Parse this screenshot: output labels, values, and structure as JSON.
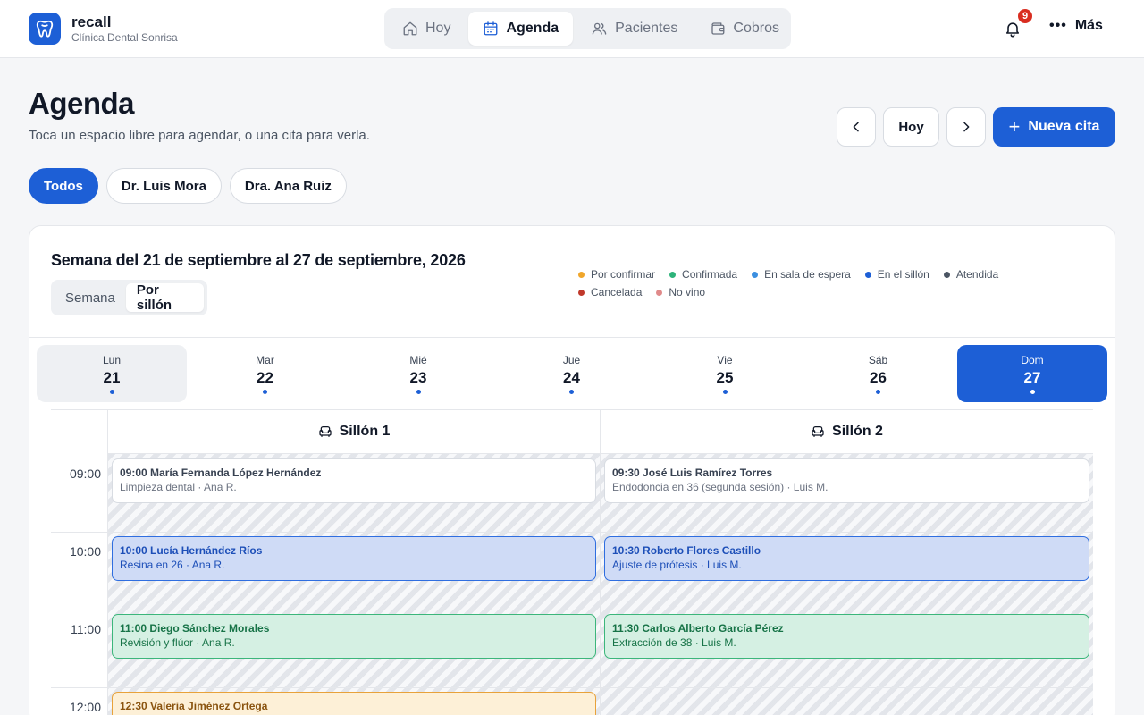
{
  "brand": {
    "name": "recall",
    "clinic": "Clínica Dental Sonrisa"
  },
  "nav": {
    "tabs": [
      {
        "label": "Hoy",
        "icon": "home-icon"
      },
      {
        "label": "Agenda",
        "icon": "calendar-icon"
      },
      {
        "label": "Pacientes",
        "icon": "users-icon"
      },
      {
        "label": "Cobros",
        "icon": "wallet-icon"
      }
    ],
    "active": "Agenda",
    "notifications": "9",
    "more_label": "Más"
  },
  "header": {
    "title": "Agenda",
    "subtitle": "Toca un espacio libre para agendar, o una cita para verla.",
    "today_label": "Hoy",
    "new_label": "Nueva cita"
  },
  "filters": {
    "chips": [
      "Todos",
      "Dr. Luis Mora",
      "Dra. Ana Ruiz"
    ],
    "active": "Todos"
  },
  "week": {
    "title": "Semana del 21 de septiembre al 27 de septiembre, 2026",
    "views": [
      "Semana",
      "Por sillón"
    ],
    "active_view": "Por sillón"
  },
  "legend": [
    {
      "label": "Por confirmar",
      "color": "#f0a62b"
    },
    {
      "label": "Confirmada",
      "color": "#2db37a"
    },
    {
      "label": "En sala de espera",
      "color": "#3b8fe0"
    },
    {
      "label": "En el sillón",
      "color": "#1d5fd6"
    },
    {
      "label": "Atendida",
      "color": "#4b5563"
    },
    {
      "label": "Cancelada",
      "color": "#c0392b"
    },
    {
      "label": "No vino",
      "color": "#e08a8a"
    }
  ],
  "days": [
    {
      "name": "Lun",
      "num": "21"
    },
    {
      "name": "Mar",
      "num": "22"
    },
    {
      "name": "Mié",
      "num": "23"
    },
    {
      "name": "Jue",
      "num": "24"
    },
    {
      "name": "Vie",
      "num": "25"
    },
    {
      "name": "Sáb",
      "num": "26"
    },
    {
      "name": "Dom",
      "num": "27"
    }
  ],
  "selected_day": "27",
  "chairs": [
    "Sillón 1",
    "Sillón 2"
  ],
  "hours": [
    "09:00",
    "10:00",
    "11:00",
    "12:00"
  ],
  "appointments": {
    "chair1": [
      {
        "title": "09:00 María Fernanda López Hernández",
        "detail": "Limpieza dental · Ana R."
      },
      {
        "title": "10:00 Lucía Hernández Ríos",
        "detail": "Resina en 26 · Ana R."
      },
      {
        "title": "11:00 Diego Sánchez Morales",
        "detail": "Revisión y flúor · Ana R."
      },
      {
        "title": "12:30 Valeria Jiménez Ortega",
        "detail": ""
      }
    ],
    "chair2": [
      {
        "title": "09:30 José Luis Ramírez Torres",
        "detail": "Endodoncia en 36 (segunda sesión) · Luis M."
      },
      {
        "title": "10:30 Roberto Flores Castillo",
        "detail": "Ajuste de prótesis · Luis M."
      },
      {
        "title": "11:30 Carlos Alberto García Pérez",
        "detail": "Extracción de 38 · Luis M."
      }
    ]
  }
}
